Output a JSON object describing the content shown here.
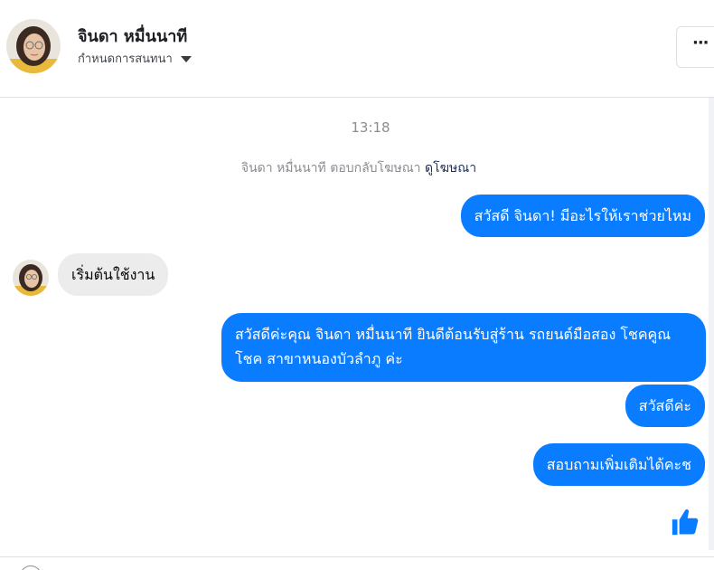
{
  "header": {
    "contact_name": "จินดา หมื่นนาที",
    "manage_label": "กำหนดการสนทนา",
    "more_label": "···"
  },
  "conversation": {
    "timestamp": "13:18",
    "ad_reply_text": "จินดา หมื่นนาที ตอบกลับโฆษณา",
    "ad_link_label": "ดูโฆษณา",
    "messages": [
      {
        "sender": "page",
        "text": "สวัสดี จินดา! มีอะไรให้เราช่วยไหม"
      },
      {
        "sender": "contact",
        "text": "เริ่มต้นใช้งาน"
      },
      {
        "sender": "page",
        "text": "สวัสดีค่ะคุณ จินดา หมื่นนาที ยินดีต้อนรับสู่ร้าน รถยนต์มือสอง โชคคูณโชค สาขาหนองบัวลำภู ค่ะ"
      },
      {
        "sender": "page",
        "text": "สวัสดีค่ะ"
      },
      {
        "sender": "page",
        "text": "สอบถามเพิ่มเติมได้คะช"
      }
    ]
  },
  "icons": {
    "like": "thumbs-up-icon",
    "avatar": "avatar",
    "caret": "caret-down-icon",
    "more": "more-horizontal-icon"
  },
  "colors": {
    "outgoing_bubble": "#0a7cff",
    "incoming_bubble": "#ececec",
    "like_icon": "#0a7cff"
  }
}
